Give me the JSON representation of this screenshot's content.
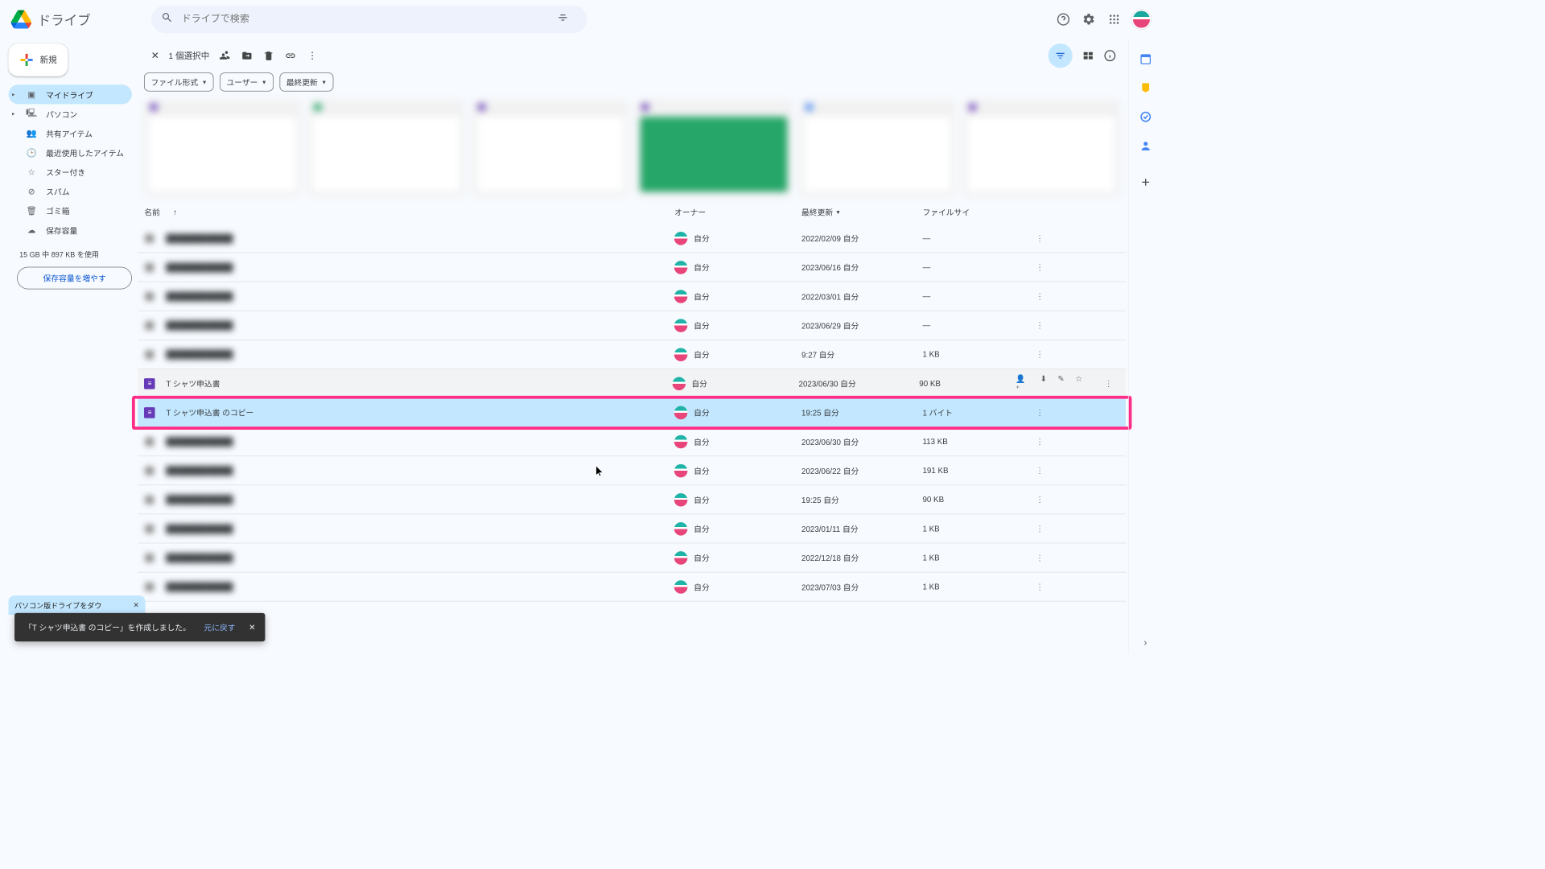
{
  "app": {
    "name": "ドライブ"
  },
  "search": {
    "placeholder": "ドライブで検索"
  },
  "sidebar": {
    "new_label": "新規",
    "items": [
      {
        "label": "マイドライブ"
      },
      {
        "label": "パソコン"
      },
      {
        "label": "共有アイテム"
      },
      {
        "label": "最近使用したアイテム"
      },
      {
        "label": "スター付き"
      },
      {
        "label": "スパム"
      },
      {
        "label": "ゴミ箱"
      },
      {
        "label": "保存容量"
      }
    ],
    "storage_text": "15 GB 中 897 KB を使用",
    "upgrade_label": "保存容量を増やす"
  },
  "toolbar": {
    "selection_count": "1 個選択中"
  },
  "filters": {
    "type": "ファイル形式",
    "user": "ユーザー",
    "modified": "最終更新"
  },
  "columns": {
    "name": "名前",
    "owner": "オーナー",
    "modified": "最終更新",
    "size": "ファイルサイ"
  },
  "owner_self": "自分",
  "files": [
    {
      "name": "",
      "owner": "自分",
      "modified": "2022/02/09 自分",
      "size": "—",
      "blur": true
    },
    {
      "name": "",
      "owner": "自分",
      "modified": "2023/06/16 自分",
      "size": "—",
      "blur": true
    },
    {
      "name": "",
      "owner": "自分",
      "modified": "2022/03/01 自分",
      "size": "—",
      "blur": true
    },
    {
      "name": "",
      "owner": "自分",
      "modified": "2023/06/29 自分",
      "size": "—",
      "blur": true
    },
    {
      "name": "",
      "owner": "自分",
      "modified": "9:27 自分",
      "size": "1 KB",
      "blur": true
    },
    {
      "name": "T シャツ申込書",
      "owner": "自分",
      "modified": "2023/06/30 自分",
      "size": "90 KB",
      "hover": true,
      "icon": "forms"
    },
    {
      "name": "T シャツ申込書 のコピー",
      "owner": "自分",
      "modified": "19:25 自分",
      "size": "1 バイト",
      "selected": true,
      "highlight": true,
      "icon": "forms"
    },
    {
      "name": "",
      "owner": "自分",
      "modified": "2023/06/30 自分",
      "size": "113 KB",
      "blur": true
    },
    {
      "name": "",
      "owner": "自分",
      "modified": "2023/06/22 自分",
      "size": "191 KB",
      "blur": true
    },
    {
      "name": "",
      "owner": "自分",
      "modified": "19:25 自分",
      "size": "90 KB",
      "blur": true
    },
    {
      "name": "",
      "owner": "自分",
      "modified": "2023/01/11 自分",
      "size": "1 KB",
      "blur": true
    },
    {
      "name": "",
      "owner": "自分",
      "modified": "2022/12/18 自分",
      "size": "1 KB",
      "blur": true
    },
    {
      "name": "",
      "owner": "自分",
      "modified": "2023/07/03 自分",
      "size": "1 KB",
      "blur": true
    }
  ],
  "download_tip": "パソコン版ドライブをダウ",
  "toast": {
    "message": "「T シャツ申込書 のコピー」を作成しました。",
    "undo": "元に戻す"
  }
}
